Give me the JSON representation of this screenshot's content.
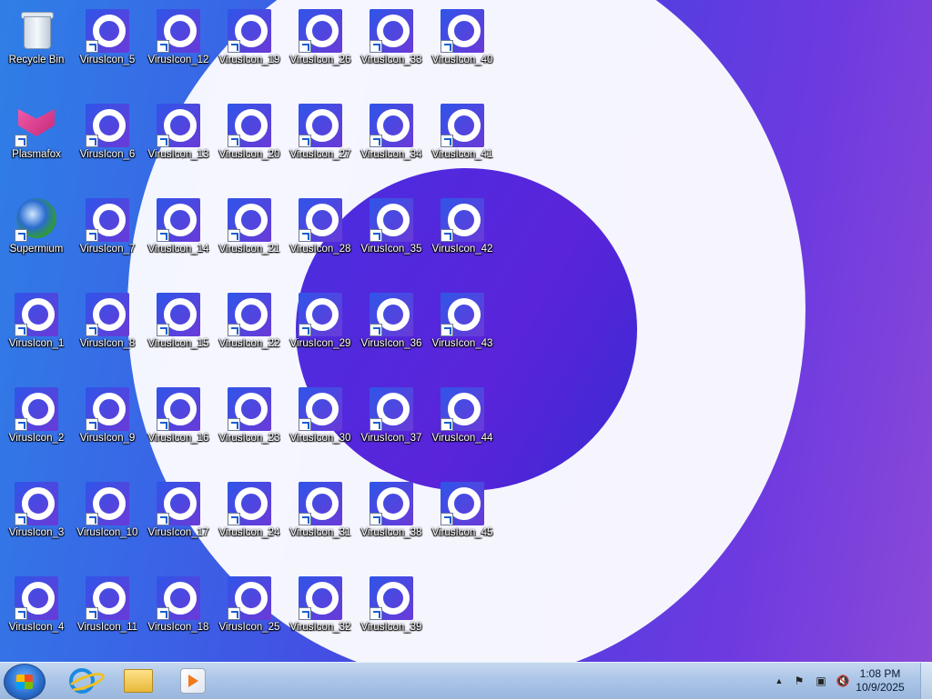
{
  "desktop": {
    "icons": [
      {
        "label": "Recycle Bin",
        "type": "recycle-bin"
      },
      {
        "label": "Plasmafox",
        "type": "plasmafox"
      },
      {
        "label": "Supermium",
        "type": "supermium"
      },
      {
        "label": "VirusIcon_1",
        "type": "virus"
      },
      {
        "label": "VirusIcon_2",
        "type": "virus"
      },
      {
        "label": "VirusIcon_3",
        "type": "virus"
      },
      {
        "label": "VirusIcon_4",
        "type": "virus"
      },
      {
        "label": "VirusIcon_5",
        "type": "virus"
      },
      {
        "label": "VirusIcon_6",
        "type": "virus"
      },
      {
        "label": "VirusIcon_7",
        "type": "virus"
      },
      {
        "label": "VirusIcon_8",
        "type": "virus"
      },
      {
        "label": "VirusIcon_9",
        "type": "virus"
      },
      {
        "label": "VirusIcon_10",
        "type": "virus"
      },
      {
        "label": "VirusIcon_11",
        "type": "virus"
      },
      {
        "label": "VirusIcon_12",
        "type": "virus"
      },
      {
        "label": "VirusIcon_13",
        "type": "virus"
      },
      {
        "label": "VirusIcon_14",
        "type": "virus"
      },
      {
        "label": "VirusIcon_15",
        "type": "virus"
      },
      {
        "label": "VirusIcon_16",
        "type": "virus"
      },
      {
        "label": "VirusIcon_17",
        "type": "virus"
      },
      {
        "label": "VirusIcon_18",
        "type": "virus"
      },
      {
        "label": "VirusIcon_19",
        "type": "virus"
      },
      {
        "label": "VirusIcon_20",
        "type": "virus"
      },
      {
        "label": "VirusIcon_21",
        "type": "virus"
      },
      {
        "label": "VirusIcon_22",
        "type": "virus"
      },
      {
        "label": "VirusIcon_23",
        "type": "virus"
      },
      {
        "label": "VirusIcon_24",
        "type": "virus"
      },
      {
        "label": "VirusIcon_25",
        "type": "virus"
      },
      {
        "label": "VirusIcon_26",
        "type": "virus"
      },
      {
        "label": "VirusIcon_27",
        "type": "virus"
      },
      {
        "label": "VirusIcon_28",
        "type": "virus"
      },
      {
        "label": "VirusIcon_29",
        "type": "virus"
      },
      {
        "label": "VirusIcon_30",
        "type": "virus"
      },
      {
        "label": "VirusIcon_31",
        "type": "virus"
      },
      {
        "label": "VirusIcon_32",
        "type": "virus"
      },
      {
        "label": "VirusIcon_33",
        "type": "virus"
      },
      {
        "label": "VirusIcon_34",
        "type": "virus"
      },
      {
        "label": "VirusIcon_35",
        "type": "virus"
      },
      {
        "label": "VirusIcon_36",
        "type": "virus"
      },
      {
        "label": "VirusIcon_37",
        "type": "virus"
      },
      {
        "label": "VirusIcon_38",
        "type": "virus"
      },
      {
        "label": "VirusIcon_39",
        "type": "virus"
      },
      {
        "label": "VirusIcon_40",
        "type": "virus"
      },
      {
        "label": "VirusIcon_41",
        "type": "virus"
      },
      {
        "label": "VirusIcon_42",
        "type": "virus"
      },
      {
        "label": "VirusIcon_43",
        "type": "virus"
      },
      {
        "label": "VirusIcon_44",
        "type": "virus"
      },
      {
        "label": "VirusIcon_45",
        "type": "virus"
      }
    ]
  },
  "taskbar": {
    "pinned": [
      {
        "name": "internet-explorer",
        "icon": "ie-icon"
      },
      {
        "name": "file-explorer",
        "icon": "folder-icon"
      },
      {
        "name": "media-player",
        "icon": "media-player-icon"
      }
    ],
    "tray": {
      "icons": [
        "show-hidden-icons-arrow",
        "action-center-flag-icon",
        "network-icon",
        "volume-muted-icon"
      ]
    },
    "clock": {
      "time": "1:08 PM",
      "date": "10/9/2025"
    }
  },
  "colors": {
    "wallpaper_blue": "#2f7fe6",
    "wallpaper_purple": "#6d3ae0",
    "taskbar": "#a9c4e6"
  }
}
